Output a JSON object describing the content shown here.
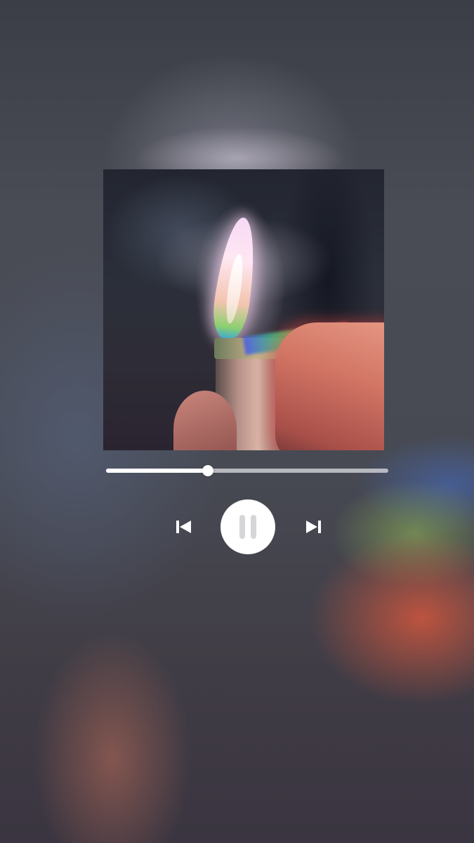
{
  "player": {
    "album_art": {
      "subject": "flame-lighter-photo"
    },
    "progress": {
      "fraction": 0.36
    },
    "controls": {
      "previous_icon": "skip-previous-icon",
      "pause_icon": "pause-icon",
      "next_icon": "skip-next-icon",
      "state": "playing"
    }
  },
  "colors": {
    "controls": "#ffffff",
    "track": "#dcdce1",
    "pause_glyph": "#d6d6d8"
  }
}
